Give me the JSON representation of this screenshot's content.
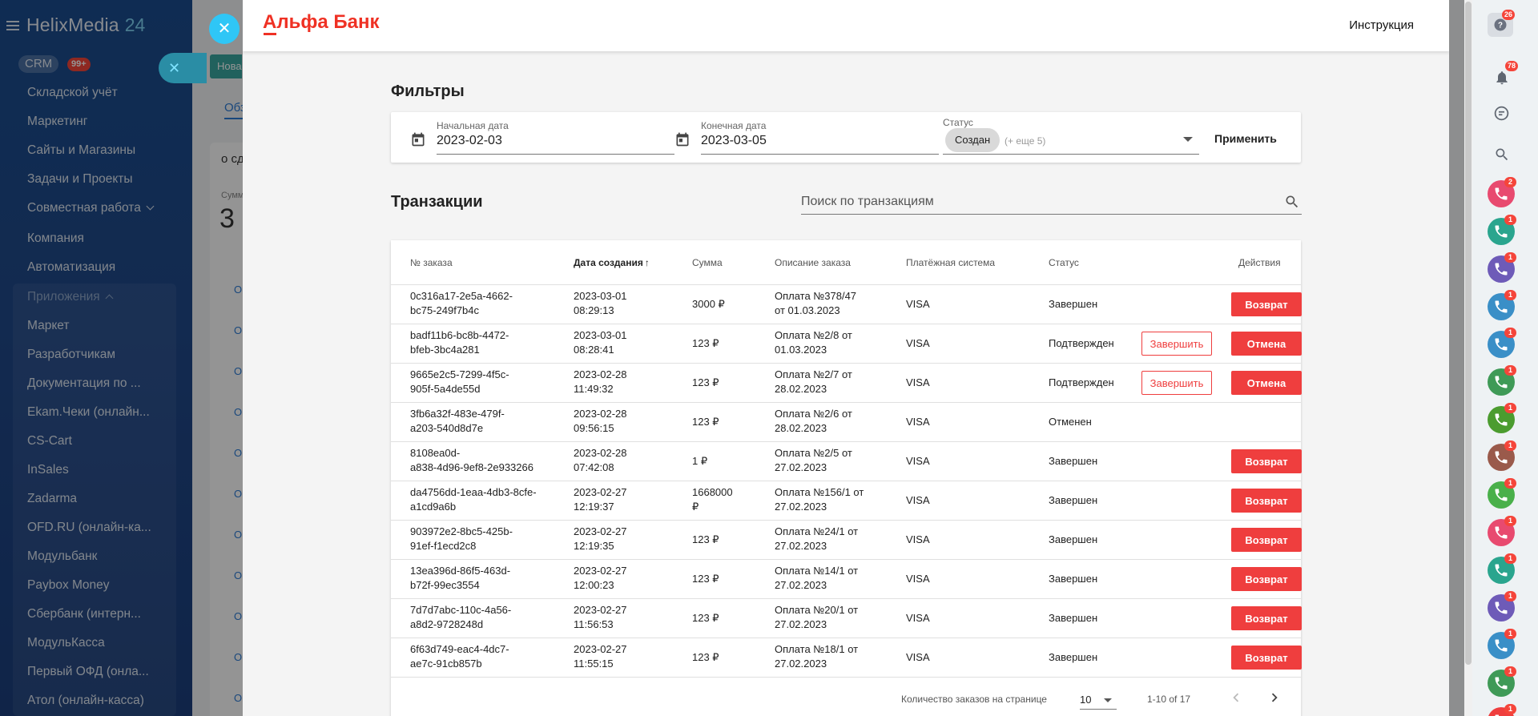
{
  "left_sidebar": {
    "logo": "HelixMedia",
    "logo_number": "24",
    "crm_label": "CRM",
    "crm_badge": "99+",
    "items": [
      {
        "label": "Складской учёт"
      },
      {
        "label": "Маркетинг"
      },
      {
        "label": "Сайты и Магазины"
      },
      {
        "label": "Задачи и Проекты"
      },
      {
        "label": "Совместная работа"
      },
      {
        "label": "Компания"
      },
      {
        "label": "Автоматизация"
      }
    ],
    "apps_label": "Приложения",
    "apps": [
      {
        "label": "Маркет"
      },
      {
        "label": "Разработчикам"
      },
      {
        "label": "Документация по ..."
      },
      {
        "label": "Ekam.Чеки (онлайн..."
      },
      {
        "label": "CS-Cart"
      },
      {
        "label": "InSales"
      },
      {
        "label": "Zadarma"
      },
      {
        "label": "OFD.RU (онлайн-ка..."
      },
      {
        "label": "Модульбанк"
      },
      {
        "label": "Paybox Money"
      },
      {
        "label": "Сбербанк (интерн..."
      },
      {
        "label": "МодульКасса"
      },
      {
        "label": "Первый ОФД (онла..."
      },
      {
        "label": "Атол (онлайн-касса)"
      }
    ]
  },
  "background": {
    "new_button": "Нова",
    "tab": "Обз",
    "card_title": "о сд",
    "card_sub": "Сумм",
    "card_big": "3",
    "row_prefix": "О"
  },
  "panel": {
    "brand": "Альфа Банк",
    "brand_first_letter": "А",
    "brand_rest": "льфа Банк",
    "instruction_link": "Инструкция"
  },
  "filters": {
    "title": "Фильтры",
    "start_label": "Начальная дата",
    "start_value": "2023-02-03",
    "end_label": "Конечная дата",
    "end_value": "2023-03-05",
    "status_label": "Статус",
    "status_chip": "Создан",
    "status_more": "(+ еще 5)",
    "apply": "Применить"
  },
  "transactions": {
    "title": "Транзакции",
    "search_placeholder": "Поиск по транзакциям",
    "columns": {
      "order": "№ заказа",
      "created": "Дата создания",
      "sum": "Сумма",
      "desc": "Описание заказа",
      "payment": "Платёжная система",
      "status": "Статус",
      "actions": "Действия"
    },
    "rows": [
      {
        "id1": "0c316a17-2e5a-4662-",
        "id2": "bc75-249f7b4c",
        "date1": "2023-03-01",
        "date2": "08:29:13",
        "sum1": "3000 ₽",
        "sum2": "",
        "desc1": "Оплата №378/47",
        "desc2": "от 01.03.2023",
        "payment": "VISA",
        "status": "Завершен",
        "finish": "",
        "action": "Возврат"
      },
      {
        "id1": "badf11b6-bc8b-4472-",
        "id2": "bfeb-3bc4a281",
        "date1": "2023-03-01",
        "date2": "08:28:41",
        "sum1": "123 ₽",
        "sum2": "",
        "desc1": "Оплата №2/8 от",
        "desc2": "01.03.2023",
        "payment": "VISA",
        "status": "Подтвержден",
        "finish": "Завершить",
        "action": "Отмена"
      },
      {
        "id1": "9665e2c5-7299-4f5c-",
        "id2": "905f-5a4de55d",
        "date1": "2023-02-28",
        "date2": "11:49:32",
        "sum1": "123 ₽",
        "sum2": "",
        "desc1": "Оплата №2/7 от",
        "desc2": "28.02.2023",
        "payment": "VISA",
        "status": "Подтвержден",
        "finish": "Завершить",
        "action": "Отмена"
      },
      {
        "id1": "3fb6a32f-483e-479f-",
        "id2": "a203-540d8d7e",
        "date1": "2023-02-28",
        "date2": "09:56:15",
        "sum1": "123 ₽",
        "sum2": "",
        "desc1": "Оплата №2/6 от",
        "desc2": "28.02.2023",
        "payment": "VISA",
        "status": "Отменен",
        "finish": "",
        "action": ""
      },
      {
        "id1": "8108ea0d-",
        "id2": "a838-4d96-9ef8-2e933266",
        "date1": "2023-02-28",
        "date2": "07:42:08",
        "sum1": "1 ₽",
        "sum2": "",
        "desc1": "Оплата №2/5 от",
        "desc2": "27.02.2023",
        "payment": "VISA",
        "status": "Завершен",
        "finish": "",
        "action": "Возврат"
      },
      {
        "id1": "da4756dd-1eaa-4db3-8cfe-",
        "id2": "a1cd9a6b",
        "date1": "2023-02-27",
        "date2": "12:19:37",
        "sum1": "1668000",
        "sum2": "₽",
        "desc1": "Оплата №156/1 от",
        "desc2": "27.02.2023",
        "payment": "VISA",
        "status": "Завершен",
        "finish": "",
        "action": "Возврат"
      },
      {
        "id1": "903972e2-8bc5-425b-",
        "id2": "91ef-f1ecd2c8",
        "date1": "2023-02-27",
        "date2": "12:19:35",
        "sum1": "123 ₽",
        "sum2": "",
        "desc1": "Оплата №24/1 от",
        "desc2": "27.02.2023",
        "payment": "VISA",
        "status": "Завершен",
        "finish": "",
        "action": "Возврат"
      },
      {
        "id1": "13ea396d-86f5-463d-",
        "id2": "b72f-99ec3554",
        "date1": "2023-02-27",
        "date2": "12:00:23",
        "sum1": "123 ₽",
        "sum2": "",
        "desc1": "Оплата №14/1 от",
        "desc2": "27.02.2023",
        "payment": "VISA",
        "status": "Завершен",
        "finish": "",
        "action": "Возврат"
      },
      {
        "id1": "7d7d7abc-110c-4a56-",
        "id2": "a8d2-9728248d",
        "date1": "2023-02-27",
        "date2": "11:56:53",
        "sum1": "123 ₽",
        "sum2": "",
        "desc1": "Оплата №20/1 от",
        "desc2": "27.02.2023",
        "payment": "VISA",
        "status": "Завершен",
        "finish": "",
        "action": "Возврат"
      },
      {
        "id1": "6f63d749-eac4-4dc7-",
        "id2": "ae7c-91cb857b",
        "date1": "2023-02-27",
        "date2": "11:55:15",
        "sum1": "123 ₽",
        "sum2": "",
        "desc1": "Оплата №18/1 от",
        "desc2": "27.02.2023",
        "payment": "VISA",
        "status": "Завершен",
        "finish": "",
        "action": "Возврат"
      }
    ],
    "pager": {
      "per_page_label": "Количество заказов на странице",
      "per_page_value": "10",
      "range": "1-10 of 17"
    }
  },
  "right_bar": {
    "help_badge": "26",
    "bell_badge": "78",
    "calls": [
      {
        "color": "#e84a6f",
        "badge": "2"
      },
      {
        "color": "#2aa58e",
        "badge": "1"
      },
      {
        "color": "#6e5bb8",
        "badge": "1"
      },
      {
        "color": "#3a8fc7",
        "badge": "1"
      },
      {
        "color": "#3a8fc7",
        "badge": "1"
      },
      {
        "color": "#3f9a57",
        "badge": "1"
      },
      {
        "color": "#4b9c2f",
        "badge": "1"
      },
      {
        "color": "#9a5a4b",
        "badge": "1"
      },
      {
        "color": "#49b04a",
        "badge": "1"
      },
      {
        "color": "#e84a6f",
        "badge": "1"
      },
      {
        "color": "#2aa58e",
        "badge": "1"
      },
      {
        "color": "#6e5bb8",
        "badge": "1"
      },
      {
        "color": "#3a8fc7",
        "badge": "1"
      },
      {
        "color": "#3f9a57",
        "badge": "1"
      },
      {
        "color": "#ef3e3e",
        "badge": "1"
      }
    ]
  },
  "colors": {
    "brand_red": "#ef3124",
    "button_red": "#ef3e3e",
    "sidebar_blue": "#1b4d8f",
    "accent_cyan": "#2fc6f6"
  }
}
